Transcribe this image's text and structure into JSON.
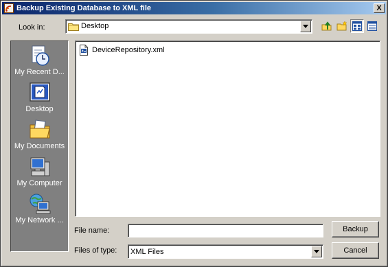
{
  "window": {
    "title": "Backup Existing Database to XML file",
    "close_glyph": "X"
  },
  "look_in": {
    "label": "Look in:",
    "value": "Desktop",
    "icon": "folder-icon"
  },
  "toolbar": {
    "icons": [
      "up-one-level-icon",
      "create-new-folder-icon",
      "list-view-icon",
      "details-view-icon"
    ],
    "active_view": "list"
  },
  "places": [
    {
      "label": "My Recent D...",
      "icon": "recent-documents-icon"
    },
    {
      "label": "Desktop",
      "icon": "desktop-icon"
    },
    {
      "label": "My Documents",
      "icon": "my-documents-icon"
    },
    {
      "label": "My Computer",
      "icon": "my-computer-icon"
    },
    {
      "label": "My Network ...",
      "icon": "my-network-icon"
    }
  ],
  "files": [
    {
      "name": "DeviceRepository.xml",
      "icon": "xml-file-icon"
    }
  ],
  "filename": {
    "label": "File name:",
    "value": ""
  },
  "filetype": {
    "label": "Files of type:",
    "value": "XML Files"
  },
  "buttons": {
    "backup": "Backup",
    "cancel": "Cancel"
  },
  "colors": {
    "title_start": "#0a246a",
    "title_end": "#a6caf0",
    "face": "#d4d0c8",
    "places_bg": "#808080"
  }
}
